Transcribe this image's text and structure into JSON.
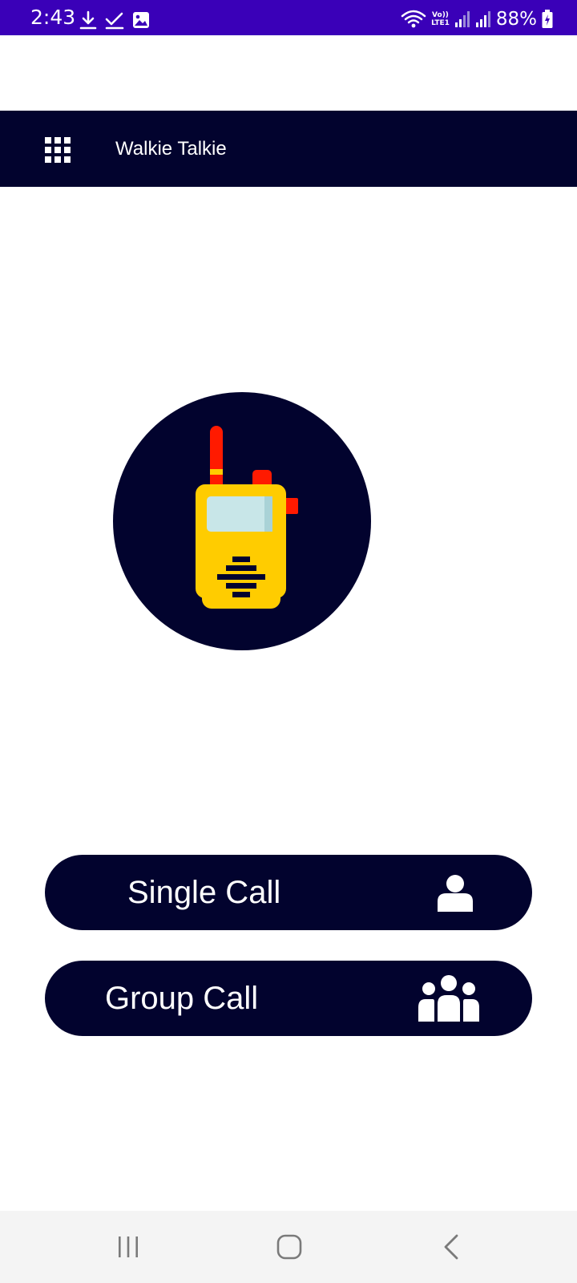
{
  "status_bar": {
    "time": "2:43",
    "lte_top": "Vo))",
    "lte_bottom": "LTE1",
    "battery_percent": "88%",
    "color": "#3a00b8"
  },
  "app_bar": {
    "title": "Walkie Talkie",
    "color": "#02032e"
  },
  "actions": {
    "single_call_label": "Single Call",
    "group_call_label": "Group Call"
  },
  "icons": {
    "menu": "grid-menu-icon",
    "hero": "walkie-talkie-icon",
    "single_call": "person-icon",
    "group_call": "group-icon",
    "nav_recents": "recents-icon",
    "nav_home": "home-icon",
    "nav_back": "back-icon"
  },
  "colors": {
    "accent_dark": "#02032e",
    "walkie_body": "#ffcc00",
    "walkie_antenna": "#ff1a00",
    "walkie_screen": "#c8e6e8"
  }
}
